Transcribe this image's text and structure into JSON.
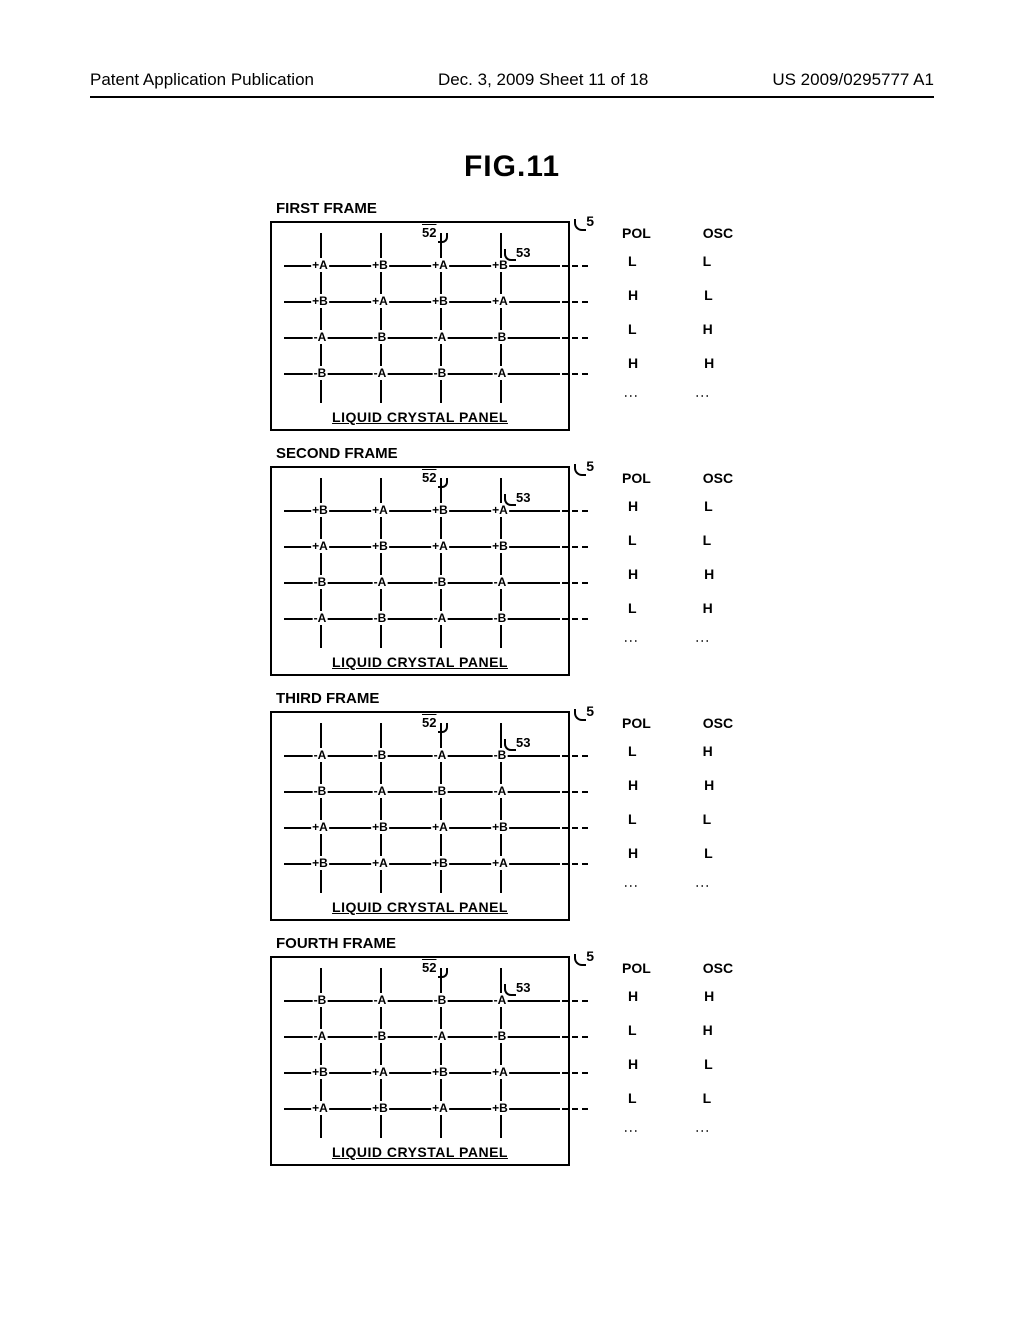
{
  "header": {
    "left": "Patent Application Publication",
    "center": "Dec. 3, 2009  Sheet 11 of 18",
    "right": "US 2009/0295777 A1"
  },
  "figure_title": "FIG.11",
  "panel_caption": "LIQUID CRYSTAL PANEL",
  "labels": {
    "ref5": "5",
    "ref52": "52",
    "ref53": "53"
  },
  "side_headers": {
    "pol": "POL",
    "osc": "OSC"
  },
  "frames": [
    {
      "title": "FIRST FRAME",
      "grid": [
        [
          "+A",
          "+B",
          "+A",
          "+B"
        ],
        [
          "+B",
          "+A",
          "+B",
          "+A"
        ],
        [
          "-A",
          "-B",
          "-A",
          "-B"
        ],
        [
          "-B",
          "-A",
          "-B",
          "-A"
        ]
      ],
      "pol": [
        "L",
        "H",
        "L",
        "H"
      ],
      "osc": [
        "L",
        "L",
        "H",
        "H"
      ]
    },
    {
      "title": "SECOND FRAME",
      "grid": [
        [
          "+B",
          "+A",
          "+B",
          "+A"
        ],
        [
          "+A",
          "+B",
          "+A",
          "+B"
        ],
        [
          "-B",
          "-A",
          "-B",
          "-A"
        ],
        [
          "-A",
          "-B",
          "-A",
          "-B"
        ]
      ],
      "pol": [
        "H",
        "L",
        "H",
        "L"
      ],
      "osc": [
        "L",
        "L",
        "H",
        "H"
      ]
    },
    {
      "title": "THIRD FRAME",
      "grid": [
        [
          "-A",
          "-B",
          "-A",
          "-B"
        ],
        [
          "-B",
          "-A",
          "-B",
          "-A"
        ],
        [
          "+A",
          "+B",
          "+A",
          "+B"
        ],
        [
          "+B",
          "+A",
          "+B",
          "+A"
        ]
      ],
      "pol": [
        "L",
        "H",
        "L",
        "H"
      ],
      "osc": [
        "H",
        "H",
        "L",
        "L"
      ]
    },
    {
      "title": "FOURTH FRAME",
      "grid": [
        [
          "-B",
          "-A",
          "-B",
          "-A"
        ],
        [
          "-A",
          "-B",
          "-A",
          "-B"
        ],
        [
          "+B",
          "+A",
          "+B",
          "+A"
        ],
        [
          "+A",
          "+B",
          "+A",
          "+B"
        ]
      ],
      "pol": [
        "H",
        "L",
        "H",
        "L"
      ],
      "osc": [
        "H",
        "H",
        "L",
        "L"
      ]
    }
  ]
}
